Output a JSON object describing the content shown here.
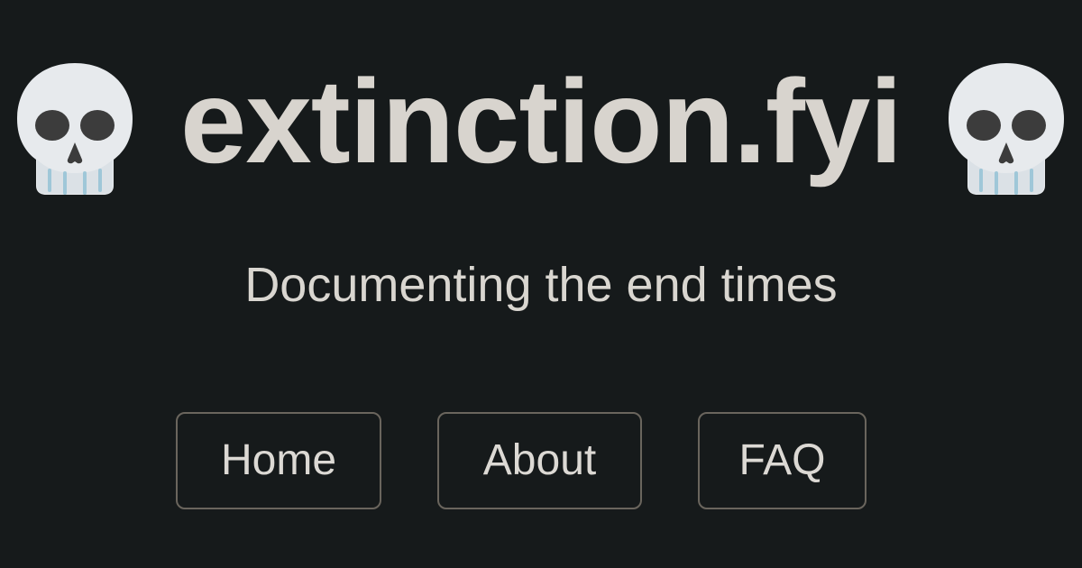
{
  "header": {
    "title": "extinction.fyi",
    "tagline": "Documenting the end times",
    "decorative_icons": [
      "skull-icon",
      "skull-icon"
    ]
  },
  "nav": {
    "items": [
      {
        "label": "Home"
      },
      {
        "label": "About"
      },
      {
        "label": "FAQ"
      }
    ]
  },
  "colors": {
    "background": "#161a1b",
    "title_text": "#d8d4ce",
    "body_text": "#d9d6d0",
    "button_border": "#6a655d",
    "skull_fill": "#e7eaed",
    "skull_shadow": "#c6cdd3",
    "skull_features": "#3c3c3c",
    "skull_teeth": "#9fc7d8"
  }
}
